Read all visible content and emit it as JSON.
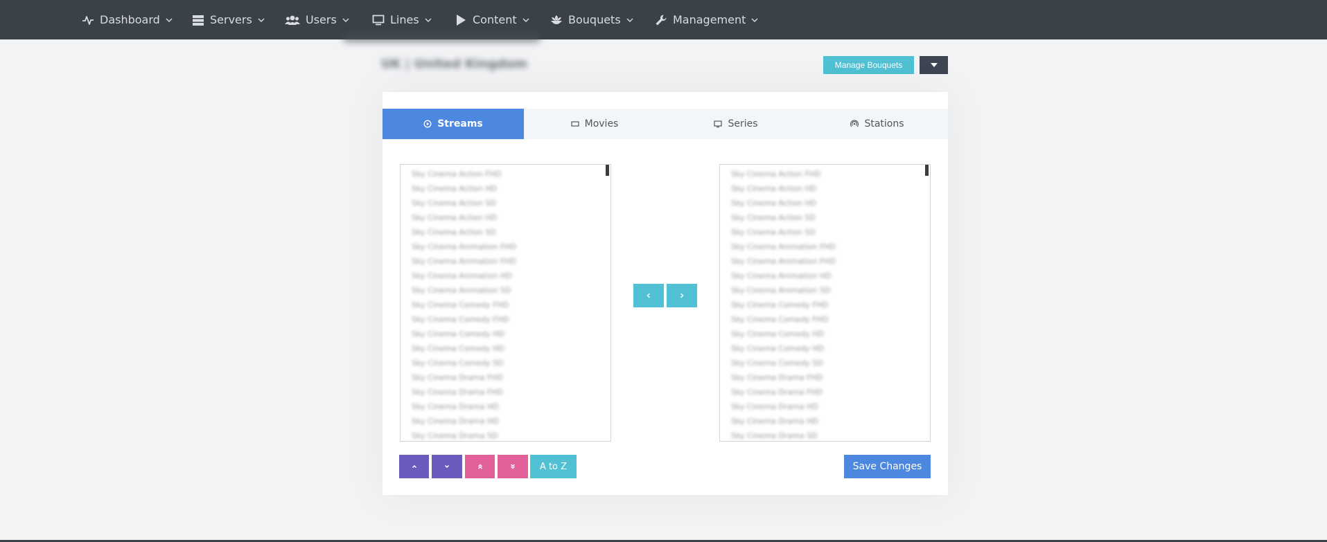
{
  "nav": {
    "items": [
      {
        "label": "Dashboard",
        "icon": "activity-icon"
      },
      {
        "label": "Servers",
        "icon": "server-icon"
      },
      {
        "label": "Users",
        "icon": "users-icon"
      },
      {
        "label": "Lines",
        "icon": "monitor-icon"
      },
      {
        "label": "Content",
        "icon": "play-icon"
      },
      {
        "label": "Bouquets",
        "icon": "bouquet-icon"
      },
      {
        "label": "Management",
        "icon": "wrench-icon"
      }
    ]
  },
  "header": {
    "title": "UK | United Kingdom",
    "manage_button": "Manage Bouquets"
  },
  "tabs": [
    {
      "label": "Streams",
      "icon": "play-circle-icon",
      "active": true
    },
    {
      "label": "Movies",
      "icon": "film-icon",
      "active": false
    },
    {
      "label": "Series",
      "icon": "tv-icon",
      "active": false
    },
    {
      "label": "Stations",
      "icon": "radio-icon",
      "active": false
    }
  ],
  "left_list": [
    "Sky Cinema Action FHD",
    "Sky Cinema Action HD",
    "Sky Cinema Action SD",
    "Sky Cinema Action HD",
    "Sky Cinema Action SD",
    "Sky Cinema Animation FHD",
    "Sky Cinema Animation FHD",
    "Sky Cinema Animation HD",
    "Sky Cinema Animation SD",
    "Sky Cinema Comedy FHD",
    "Sky Cinema Comedy FHD",
    "Sky Cinema Comedy HD",
    "Sky Cinema Comedy HD",
    "Sky Cinema Comedy SD",
    "Sky Cinema Drama FHD",
    "Sky Cinema Drama FHD",
    "Sky Cinema Drama HD",
    "Sky Cinema Drama HD",
    "Sky Cinema Drama SD"
  ],
  "right_list": [
    "Sky Cinema Action FHD",
    "Sky Cinema Action HD",
    "Sky Cinema Action HD",
    "Sky Cinema Action SD",
    "Sky Cinema Action SD",
    "Sky Cinema Animation FHD",
    "Sky Cinema Animation FHD",
    "Sky Cinema Animation HD",
    "Sky Cinema Animation SD",
    "Sky Cinema Comedy FHD",
    "Sky Cinema Comedy FHD",
    "Sky Cinema Comedy HD",
    "Sky Cinema Comedy HD",
    "Sky Cinema Comedy SD",
    "Sky Cinema Drama FHD",
    "Sky Cinema Drama FHD",
    "Sky Cinema Drama HD",
    "Sky Cinema Drama HD",
    "Sky Cinema Drama SD"
  ],
  "sort_buttons": {
    "az_label": "A to Z"
  },
  "save_button": "Save Changes",
  "colors": {
    "nav_bg": "#3b4149",
    "primary": "#4c88e0",
    "info": "#4fc1d3",
    "purple": "#6a5bbd",
    "pink": "#e3619a",
    "dark": "#3e4552"
  }
}
